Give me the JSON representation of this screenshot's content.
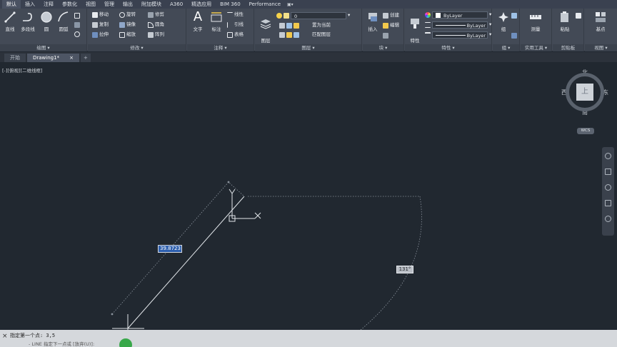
{
  "tabs": [
    "默认",
    "插入",
    "注释",
    "参数化",
    "视图",
    "管理",
    "输出",
    "附加模块",
    "A360",
    "精选应用",
    "BIM 360",
    "Performance"
  ],
  "tabs_more": "▣▾",
  "panels": {
    "draw": {
      "title": "绘图 ▾",
      "line": "直线",
      "polyline": "多段线",
      "circle": "圆",
      "arc": "圆弧"
    },
    "modify": {
      "title": "修改 ▾",
      "move": "移动",
      "rotate": "旋转",
      "trim": "修剪",
      "copy": "复制",
      "mirror": "镜像",
      "fillet": "圆角",
      "stretch": "拉伸",
      "scale": "缩放",
      "array": "阵列"
    },
    "annotation": {
      "title": "注释 ▾",
      "text": "文字",
      "dim": "标注",
      "linear": "线性",
      "leader": "引线",
      "table": "表格"
    },
    "layers": {
      "title": "图层 ▾",
      "props": "图层\n特性",
      "current_layer": "0",
      "make_current": "置为当前",
      "match_layer": "匹配图层"
    },
    "block": {
      "title": "块 ▾",
      "insert": "插入",
      "create": "创建",
      "edit": "编辑"
    },
    "properties": {
      "title": "特性 ▾",
      "match": "特性\n匹配",
      "color": "ByLayer",
      "linetype": "ByLayer",
      "lineweight": "ByLayer"
    },
    "groups": {
      "title": "组 ▾",
      "group": "组"
    },
    "utilities": {
      "title": "实用工具 ▾",
      "measure": "测量"
    },
    "clipboard": {
      "title": "剪贴板",
      "paste": "粘贴"
    },
    "view": {
      "title": "视图 ▾",
      "base": "基点"
    }
  },
  "doc_tabs": {
    "start": "开始",
    "drawing": "Drawing1*",
    "close": "×",
    "add": "+"
  },
  "viewport_label": "[-][俯视][二维线框]",
  "viewcube": {
    "north": "北",
    "south": "南",
    "east": "东",
    "west": "西",
    "face": "上",
    "wcs": "WCS"
  },
  "dynamic_input": {
    "length": "39.8723",
    "angle": "131°"
  },
  "ucs": {
    "x": "X",
    "y": "Y"
  },
  "command": {
    "history": "指定第一个点: 3,5",
    "close": "×",
    "next": "- LINE 指定下一点或 [放弃(U)]:"
  },
  "colors": {
    "ribbon": "#434a56",
    "canvas": "#212830",
    "accent": "#2d5fae",
    "cmd_bg": "#d5d8dc"
  }
}
